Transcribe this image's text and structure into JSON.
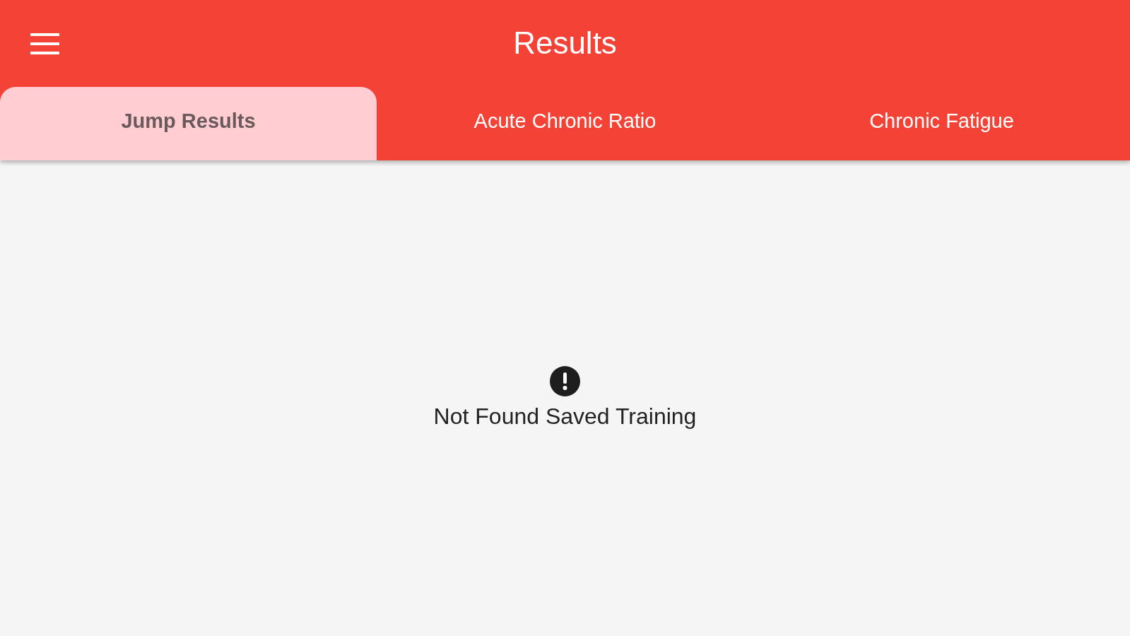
{
  "app_bar": {
    "title": "Results"
  },
  "tabs": [
    {
      "label": "Jump Results",
      "selected": true
    },
    {
      "label": "Acute Chronic Ratio",
      "selected": false
    },
    {
      "label": "Chronic Fatigue",
      "selected": false
    }
  ],
  "empty_state": {
    "message": "Not Found Saved Training"
  }
}
